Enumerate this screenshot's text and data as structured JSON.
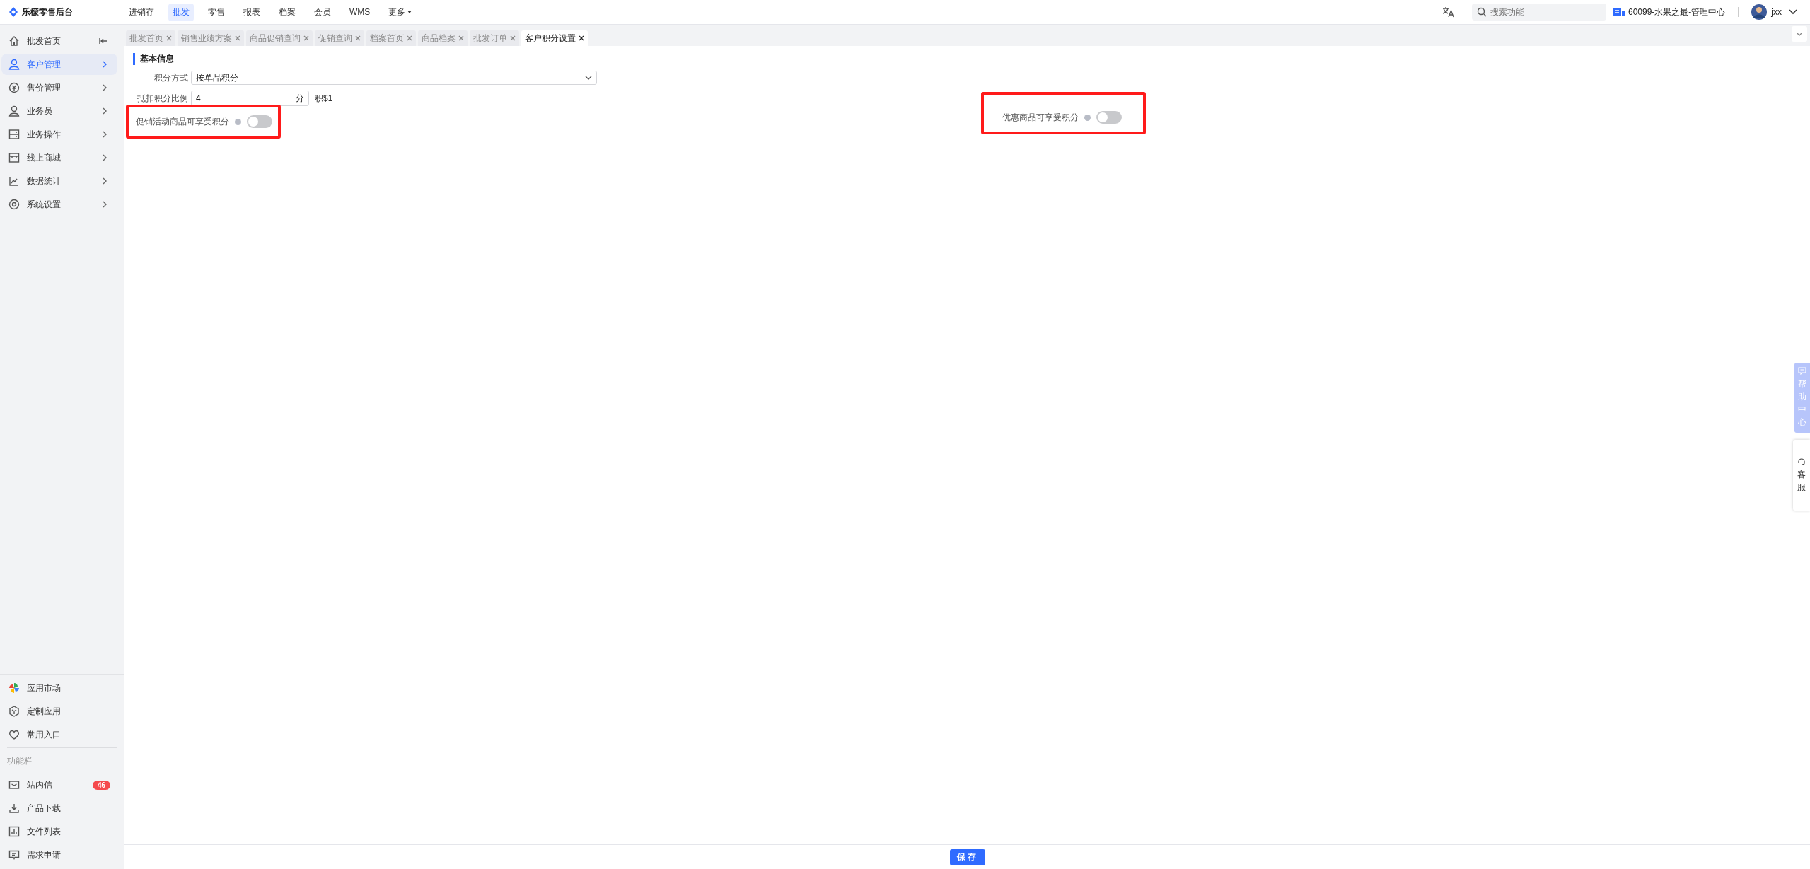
{
  "app": {
    "title": "乐檬零售后台"
  },
  "top_nav": [
    {
      "label": "进销存",
      "selected": false
    },
    {
      "label": "批发",
      "selected": true
    },
    {
      "label": "零售",
      "selected": false
    },
    {
      "label": "报表",
      "selected": false
    },
    {
      "label": "档案",
      "selected": false
    },
    {
      "label": "会员",
      "selected": false
    },
    {
      "label": "WMS",
      "selected": false
    },
    {
      "label": "更多",
      "selected": false,
      "kind": "dropdown"
    }
  ],
  "search": {
    "placeholder": "搜索功能"
  },
  "store": "60099-水果之最-管理中心",
  "user": {
    "name": "jxx"
  },
  "sidebar": {
    "items": [
      {
        "label": "批发首页",
        "selected": false,
        "kind": "home"
      },
      {
        "label": "客户管理",
        "selected": true,
        "kind": "expand"
      },
      {
        "label": "售价管理",
        "selected": false,
        "kind": "expand"
      },
      {
        "label": "业务员",
        "selected": false,
        "kind": "expand"
      },
      {
        "label": "业务操作",
        "selected": false,
        "kind": "expand"
      },
      {
        "label": "线上商城",
        "selected": false,
        "kind": "expand"
      },
      {
        "label": "数据统计",
        "selected": false,
        "kind": "expand"
      },
      {
        "label": "系统设置",
        "selected": false,
        "kind": "expand"
      }
    ],
    "bottom_items": [
      {
        "label": "应用市场"
      },
      {
        "label": "定制应用"
      },
      {
        "label": "常用入口"
      }
    ],
    "section_title": "功能栏",
    "function_items": [
      {
        "label": "站内信",
        "badge": "46"
      },
      {
        "label": "产品下载"
      },
      {
        "label": "文件列表"
      },
      {
        "label": "需求申请"
      }
    ]
  },
  "tabs": [
    {
      "label": "批发首页",
      "selected": false
    },
    {
      "label": "销售业绩方案",
      "selected": false
    },
    {
      "label": "商品促销查询",
      "selected": false
    },
    {
      "label": "促销查询",
      "selected": false
    },
    {
      "label": "档案首页",
      "selected": false
    },
    {
      "label": "商品档案",
      "selected": false
    },
    {
      "label": "批发订单",
      "selected": false
    },
    {
      "label": "客户积分设置",
      "selected": true
    }
  ],
  "form": {
    "section": "基本信息",
    "mode": {
      "label": "积分方式",
      "value": "按单品积分"
    },
    "ratio": {
      "label": "抵扣积分比例",
      "value": "4",
      "unit": "分",
      "suffix": "积$1"
    },
    "toggles": [
      {
        "label": "促销活动商品可享受积分",
        "on": false,
        "highlighted": true
      },
      {
        "label": "优惠商品可享受积分",
        "on": false,
        "highlighted": true
      }
    ]
  },
  "help_chars": [
    "帮",
    "助",
    "中",
    "心"
  ],
  "service_chars": [
    "客",
    "服"
  ],
  "save_button": "保存"
}
